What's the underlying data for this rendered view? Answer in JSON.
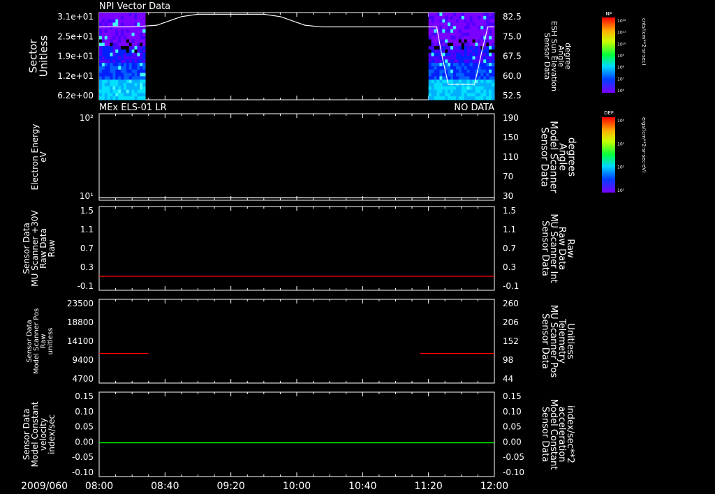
{
  "date_label": "2009/060",
  "time_ticks": [
    "08:00",
    "08:40",
    "09:20",
    "10:00",
    "10:40",
    "11:20",
    "12:00"
  ],
  "colorbars": [
    {
      "header": "NF",
      "unit": "cnts/(cm**2-sr-sec)",
      "ticks": [
        "10¹²",
        "10¹¹",
        "10¹⁰",
        "10⁹",
        "10⁸",
        "10⁷",
        "10⁶"
      ]
    },
    {
      "header": "DEF",
      "unit": "ergs/(cm**2-sr-sec-eV)",
      "ticks": [
        "10⁴",
        "10³",
        "10²",
        "10¹"
      ]
    }
  ],
  "chart_data": [
    {
      "type": "heatmap",
      "title": "NPI Vector Data",
      "ylabel": [
        "Sector",
        "Unitless"
      ],
      "y_ticks": [
        "3.1e+01",
        "2.5e+01",
        "1.9e+01",
        "1.2e+01",
        "6.2e+00"
      ],
      "data_segments": [
        [
          "08:00",
          "08:28"
        ],
        [
          "11:20",
          "12:00"
        ]
      ],
      "overlay": {
        "name": "Sensor Data ESH Sun Elevation Angle",
        "right_label": [
          "Sensor Data",
          "ESH Sun Elevation",
          "Angle",
          "degree"
        ],
        "right_ticks": [
          "82.5",
          "75.0",
          "67.5",
          "60.0",
          "52.5"
        ],
        "ylim": [
          46,
          82.5
        ],
        "x": [
          "08:00",
          "08:20",
          "08:35",
          "08:50",
          "09:00",
          "09:40",
          "09:50",
          "10:05",
          "10:15",
          "11:20",
          "11:25",
          "11:28",
          "11:32",
          "11:42",
          "11:48",
          "11:52",
          "11:56",
          "12:00"
        ],
        "y": [
          76.5,
          76.5,
          77.2,
          80.8,
          81.8,
          81.8,
          80.8,
          77.2,
          76.5,
          76.5,
          76.5,
          65.0,
          52.5,
          52.5,
          52.5,
          65.0,
          76.5,
          76.5
        ],
        "color": "#ffffff"
      }
    },
    {
      "type": "line",
      "title": "MEx ELS-01 LR",
      "status": "NO DATA",
      "ylabel": [
        "Electron Energy",
        "eV"
      ],
      "y_ticks": [
        "10²",
        "10¹"
      ],
      "right_label": [
        "Sensor Data",
        "Model Scanner",
        "Angle",
        "degrees"
      ],
      "right_ticks": [
        "190",
        "150",
        "110",
        "70",
        "30"
      ],
      "ylim": [
        10,
        190
      ],
      "series": [
        {
          "x": [
            "08:00",
            "12:00"
          ],
          "y": [
            15,
            15
          ],
          "color": "#ffffff"
        }
      ]
    },
    {
      "type": "line",
      "ylabel": [
        "Sensor Data",
        "MU Scanner +30V",
        "Raw Data",
        "Raw"
      ],
      "right_label": [
        "Sensor Data",
        "MU Scanner Int",
        "Raw Data",
        "Raw"
      ],
      "right_color": "#ff0000",
      "y_ticks": [
        "1.5",
        "1.1",
        "0.7",
        "0.3",
        "-0.1"
      ],
      "right_ticks": [
        "1.5",
        "1.1",
        "0.7",
        "0.3",
        "-0.1"
      ],
      "ylim": [
        -0.3,
        1.5
      ],
      "series": [
        {
          "x": [
            "08:00",
            "12:00"
          ],
          "y": [
            0.0,
            0.0
          ],
          "color": "#ff0000"
        }
      ]
    },
    {
      "type": "line",
      "ylabel": [
        "Sensor Data",
        "Model Scanner Pos",
        "Raw",
        "unitless"
      ],
      "right_label": [
        "Sensor Data",
        "MU Scanner Pos",
        "Telemetry",
        "Unitless"
      ],
      "right_color": "#ff0000",
      "y_ticks": [
        "23500",
        "18800",
        "14100",
        "9400",
        "4700"
      ],
      "right_ticks": [
        "260",
        "206",
        "152",
        "98",
        "44"
      ],
      "ylim": [
        0,
        23500
      ],
      "series": [
        {
          "x": [
            "08:00",
            "08:30"
          ],
          "y": [
            8300,
            8300
          ],
          "color": "#ff0000"
        },
        {
          "x": [
            "11:15",
            "12:00"
          ],
          "y": [
            8300,
            8300
          ],
          "color": "#ff0000"
        }
      ]
    },
    {
      "type": "line",
      "ylabel": [
        "Sensor Data",
        "Model Constant",
        "velocity",
        "index/sec"
      ],
      "right_label": [
        "Sensor Data",
        "Model Constant",
        "acceleration",
        "index/sec**2"
      ],
      "right_color": "#00ff00",
      "y_ticks": [
        "0.15",
        "0.10",
        "0.05",
        "0.00",
        "-0.05",
        "-0.10"
      ],
      "right_ticks": [
        "0.15",
        "0.10",
        "0.05",
        "0.00",
        "-0.05",
        "-0.10"
      ],
      "ylim": [
        -0.1,
        0.15
      ],
      "series": [
        {
          "x": [
            "08:00",
            "12:00"
          ],
          "y": [
            0,
            0
          ],
          "color": "#00ff00"
        }
      ]
    }
  ]
}
